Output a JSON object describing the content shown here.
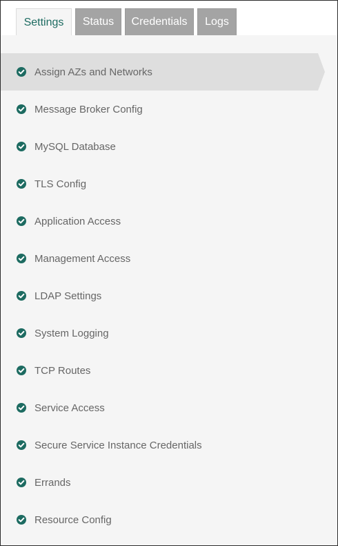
{
  "tabs": [
    {
      "label": "Settings",
      "active": true
    },
    {
      "label": "Status",
      "active": false
    },
    {
      "label": "Credentials",
      "active": false
    },
    {
      "label": "Logs",
      "active": false
    }
  ],
  "colors": {
    "accent": "#1d6b61",
    "check": "#1d6b61",
    "tab_inactive": "#a4a4a4",
    "selected_item": "#dedede"
  },
  "nav": {
    "items": [
      {
        "label": "Assign AZs and Networks",
        "status": "complete",
        "selected": true
      },
      {
        "label": "Message Broker Config",
        "status": "complete",
        "selected": false
      },
      {
        "label": "MySQL Database",
        "status": "complete",
        "selected": false
      },
      {
        "label": "TLS Config",
        "status": "complete",
        "selected": false
      },
      {
        "label": "Application Access",
        "status": "complete",
        "selected": false
      },
      {
        "label": "Management Access",
        "status": "complete",
        "selected": false
      },
      {
        "label": "LDAP Settings",
        "status": "complete",
        "selected": false
      },
      {
        "label": "System Logging",
        "status": "complete",
        "selected": false
      },
      {
        "label": "TCP Routes",
        "status": "complete",
        "selected": false
      },
      {
        "label": "Service Access",
        "status": "complete",
        "selected": false
      },
      {
        "label": "Secure Service Instance Credentials",
        "status": "complete",
        "selected": false
      },
      {
        "label": "Errands",
        "status": "complete",
        "selected": false
      },
      {
        "label": "Resource Config",
        "status": "complete",
        "selected": false
      }
    ],
    "status_icon": "check-circle-icon"
  }
}
